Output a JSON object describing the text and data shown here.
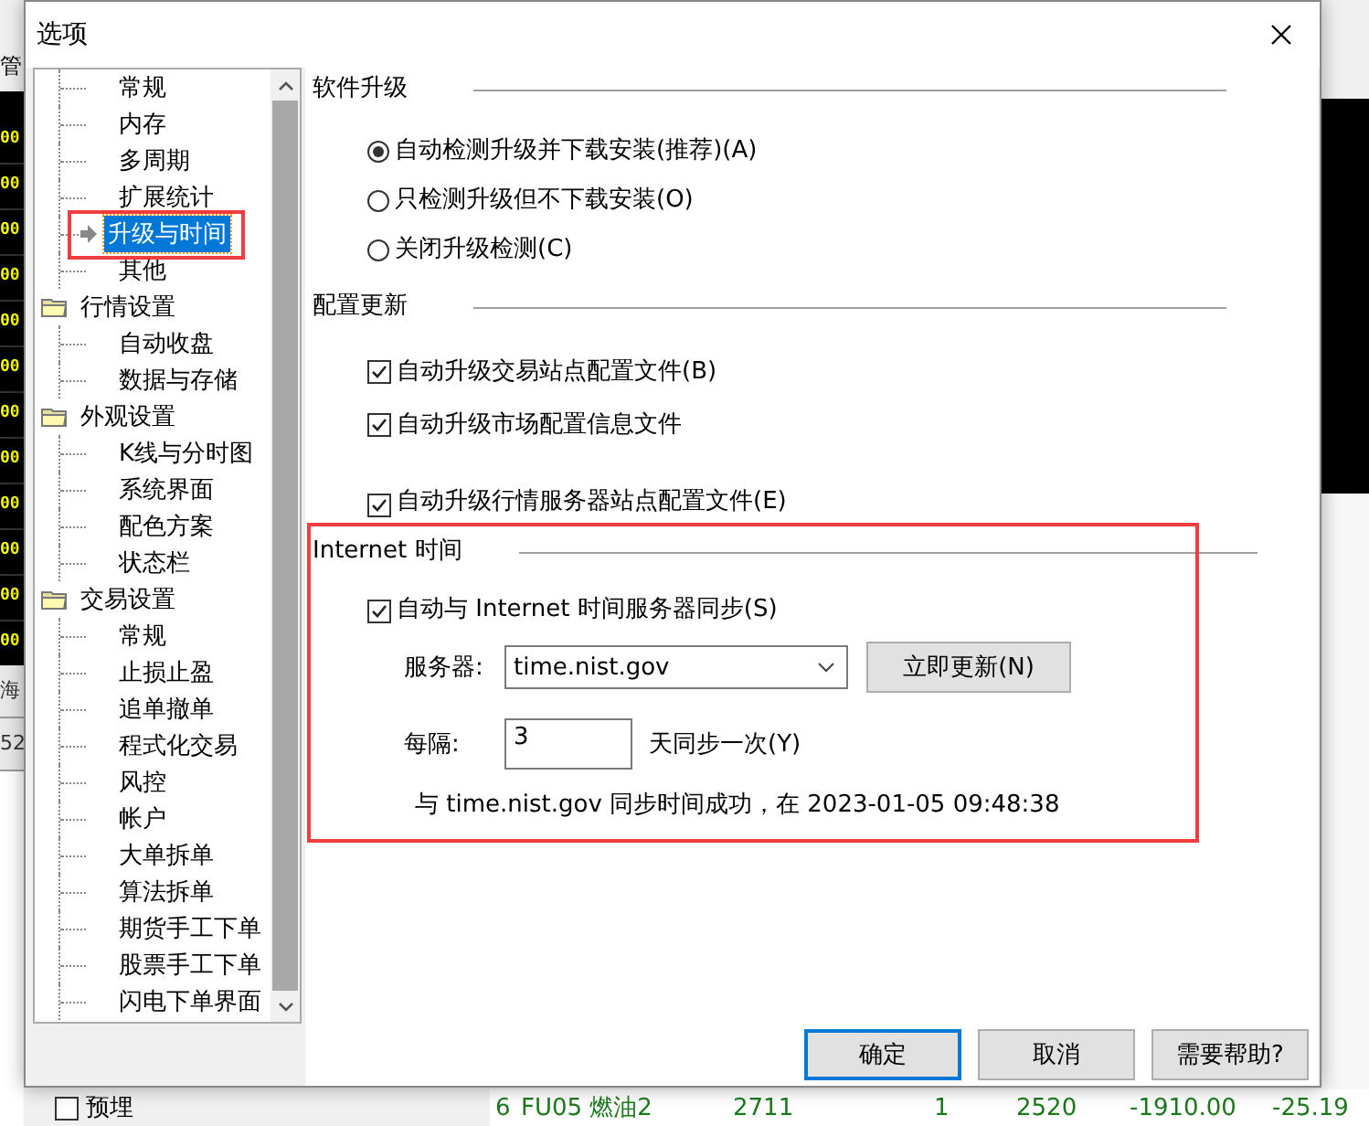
{
  "window": {
    "title": "选项"
  },
  "background_app": {
    "left_column": {
      "header": "管",
      "cells": [
        "00",
        "00",
        "00",
        "00",
        "00",
        "00",
        "00",
        "00",
        "00",
        "00",
        "00",
        "00"
      ],
      "footer_cells": [
        "海",
        "52"
      ]
    },
    "bottom_checkbox": {
      "label": "预埋",
      "checked": false
    },
    "bottom_row": [
      "6",
      "FU05 燃油2",
      "2711",
      "1",
      "2520",
      "-1910.00",
      "-25.19"
    ]
  },
  "tree": [
    {
      "children": [
        {
          "label": "常规",
          "selected": false
        },
        {
          "label": "内存",
          "selected": false
        },
        {
          "label": "多周期",
          "selected": false
        },
        {
          "label": "扩展统计",
          "selected": false
        },
        {
          "label": "升级与时间",
          "selected": true
        },
        {
          "label": "其他",
          "selected": false
        }
      ]
    },
    {
      "label": "行情设置",
      "expanded": true,
      "children": [
        {
          "label": "自动收盘",
          "selected": false
        },
        {
          "label": "数据与存储",
          "selected": false
        }
      ]
    },
    {
      "label": "外观设置",
      "expanded": true,
      "children": [
        {
          "label": "K线与分时图",
          "selected": false
        },
        {
          "label": "系统界面",
          "selected": false
        },
        {
          "label": "配色方案",
          "selected": false
        },
        {
          "label": "状态栏",
          "selected": false
        }
      ]
    },
    {
      "label": "交易设置",
      "expanded": true,
      "children": [
        {
          "label": "常规",
          "selected": false
        },
        {
          "label": "止损止盈",
          "selected": false
        },
        {
          "label": "追单撤单",
          "selected": false
        },
        {
          "label": "程式化交易",
          "selected": false
        },
        {
          "label": "风控",
          "selected": false
        },
        {
          "label": "帐户",
          "selected": false
        },
        {
          "label": "大单拆单",
          "selected": false
        },
        {
          "label": "算法拆单",
          "selected": false
        },
        {
          "label": "期货手工下单",
          "selected": false
        },
        {
          "label": "股票手工下单",
          "selected": false
        },
        {
          "label": "闪电下单界面",
          "selected": false
        }
      ]
    }
  ],
  "upgrade": {
    "title": "软件升级",
    "options": [
      {
        "label": "自动检测升级并下载安装(推荐)(A)",
        "selected": true
      },
      {
        "label": "只检测升级但不下载安装(O)",
        "selected": false
      },
      {
        "label": "关闭升级检测(C)",
        "selected": false
      }
    ]
  },
  "config_update": {
    "title": "配置更新",
    "options": [
      {
        "label": "自动升级交易站点配置文件(B)",
        "checked": true
      },
      {
        "label": "自动升级市场配置信息文件",
        "checked": true
      },
      {
        "label": "自动升级行情服务器站点配置文件(E)",
        "checked": true
      }
    ]
  },
  "internet_time": {
    "title": "Internet 时间",
    "sync": {
      "label": "自动与 Internet 时间服务器同步(S)",
      "checked": true
    },
    "server_label": "服务器:",
    "server": "time.nist.gov",
    "update_button": "立即更新(N)",
    "interval_label": "每隔:",
    "interval": "3",
    "interval_unit": "天同步一次(Y)",
    "status": "与 time.nist.gov 同步时间成功，在 2023-01-05 09:48:38"
  },
  "buttons": [
    {
      "label": "确定",
      "default": true
    },
    {
      "label": "取消",
      "default": false
    },
    {
      "label": "需要帮助?",
      "default": false
    }
  ]
}
